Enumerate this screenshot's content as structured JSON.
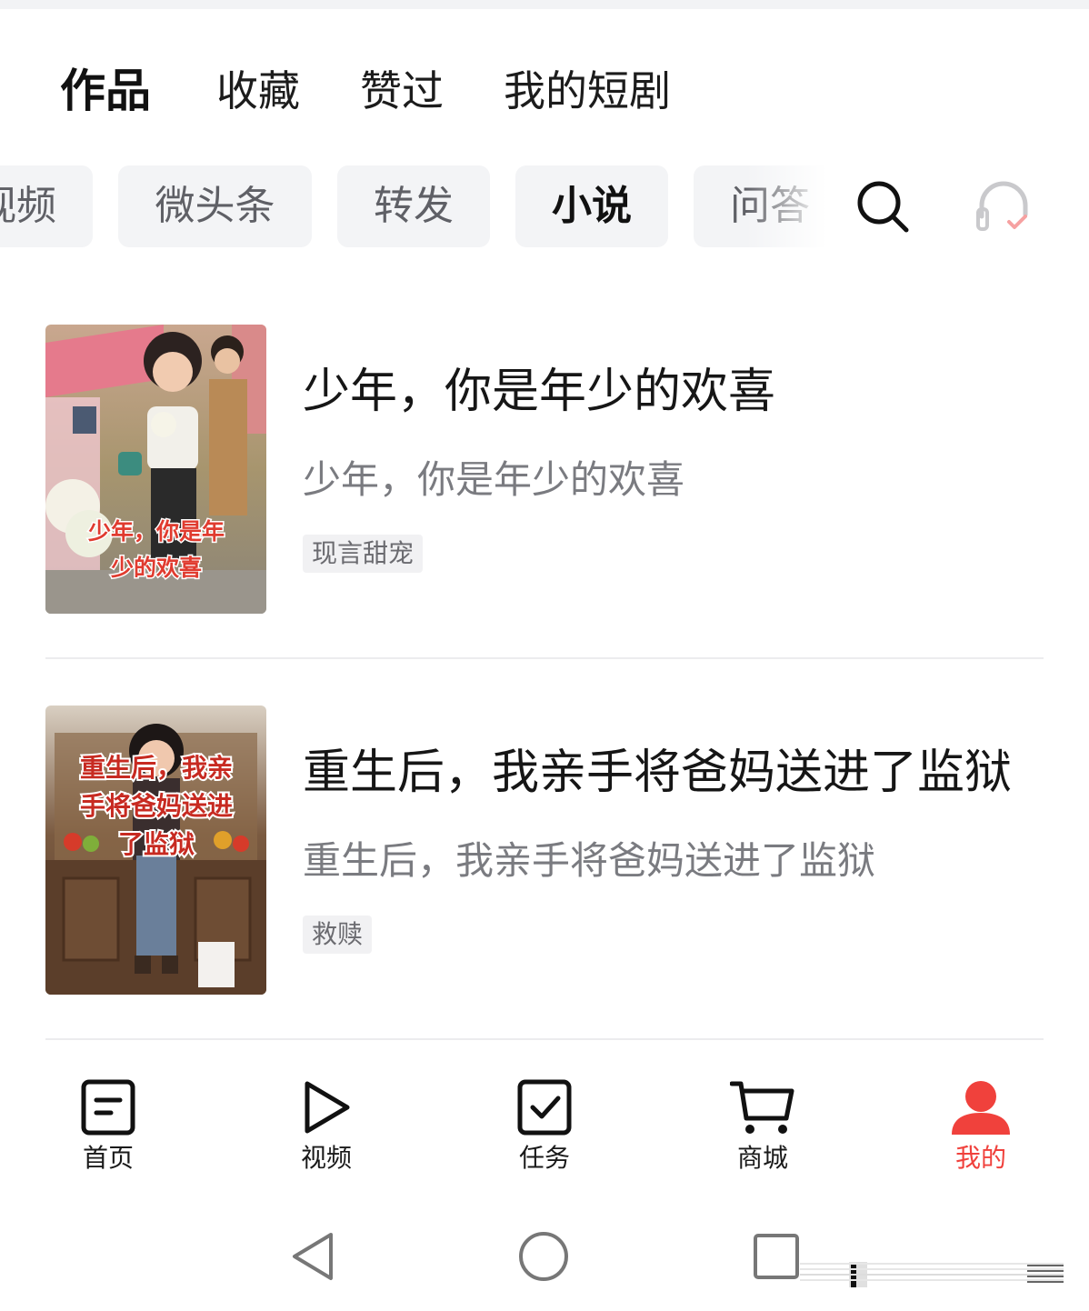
{
  "tabs": [
    {
      "label": "作品",
      "active": true
    },
    {
      "label": "收藏",
      "active": false
    },
    {
      "label": "赞过",
      "active": false
    },
    {
      "label": "我的短剧",
      "active": false
    }
  ],
  "chips": [
    {
      "label": "视频",
      "active": false
    },
    {
      "label": "微头条",
      "active": false
    },
    {
      "label": "转发",
      "active": false
    },
    {
      "label": "小说",
      "active": true
    },
    {
      "label": "问答",
      "active": false
    }
  ],
  "toolbar": {
    "search_icon": "search-icon",
    "listen_icon": "headphones-icon"
  },
  "novels": [
    {
      "title": "少年，你是年少的欢喜",
      "subtitle": "少年，你是年少的欢喜",
      "tag": "现言甜宠",
      "cover_text": "少年，你是年少的欢喜"
    },
    {
      "title": "重生后，我亲手将爸妈送进了监狱",
      "subtitle": "重生后，我亲手将爸妈送进了监狱",
      "tag": "救赎",
      "cover_text": "重生后，我亲手将爸妈送进了监狱"
    }
  ],
  "bottom_nav": [
    {
      "label": "首页",
      "icon": "home-doc-icon",
      "active": false
    },
    {
      "label": "视频",
      "icon": "play-icon",
      "active": false
    },
    {
      "label": "任务",
      "icon": "task-check-icon",
      "active": false
    },
    {
      "label": "商城",
      "icon": "cart-icon",
      "active": false
    },
    {
      "label": "我的",
      "icon": "person-icon",
      "active": true
    }
  ],
  "colors": {
    "accent": "#f0413c",
    "chip_bg": "#f3f4f6",
    "muted_text": "#7a7b80"
  }
}
